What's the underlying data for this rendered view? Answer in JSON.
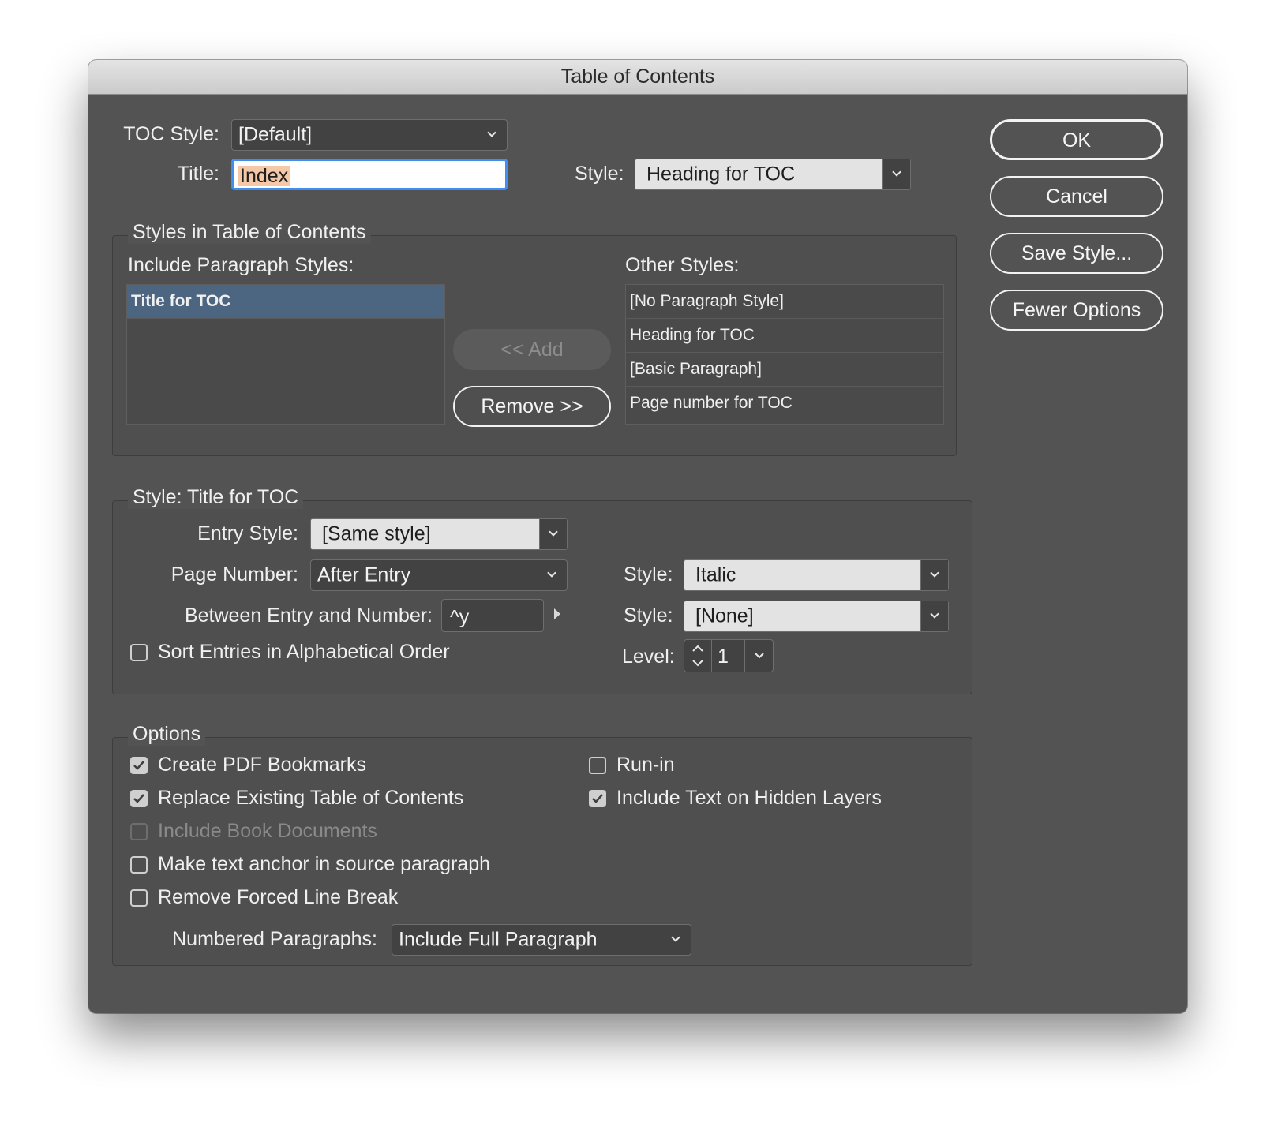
{
  "window": {
    "title": "Table of Contents"
  },
  "top": {
    "toc_style_label": "TOC Style:",
    "toc_style_value": "[Default]",
    "title_label": "Title:",
    "title_value": "Index",
    "style_label": "Style:",
    "style_value": "Heading for TOC"
  },
  "buttons": {
    "ok": "OK",
    "cancel": "Cancel",
    "save_style": "Save Style...",
    "fewer_options": "Fewer Options"
  },
  "styles_in_toc": {
    "group_title": "Styles in Table of Contents",
    "include_label": "Include Paragraph Styles:",
    "include_items": [
      "Title for TOC"
    ],
    "add_label": "<< Add",
    "remove_label": "Remove >>",
    "other_label": "Other Styles:",
    "other_items": [
      "[No Paragraph Style]",
      "Heading for TOC",
      "[Basic Paragraph]",
      "Page number for TOC"
    ]
  },
  "style_section": {
    "group_title": "Style: Title for TOC",
    "entry_style_label": "Entry Style:",
    "entry_style_value": "[Same style]",
    "page_number_label": "Page Number:",
    "page_number_value": "After Entry",
    "page_number_style_label": "Style:",
    "page_number_style_value": "Italic",
    "between_label": "Between Entry and Number:",
    "between_value": "^y",
    "between_style_label": "Style:",
    "between_style_value": "[None]",
    "sort_label": "Sort Entries in Alphabetical Order",
    "sort_checked": false,
    "level_label": "Level:",
    "level_value": "1"
  },
  "options": {
    "group_title": "Options",
    "create_pdf_bookmarks": "Create PDF Bookmarks",
    "replace_existing": "Replace Existing Table of Contents",
    "include_book_documents": "Include Book Documents",
    "make_text_anchor": "Make text anchor in source paragraph",
    "remove_forced_line_break": "Remove Forced Line Break",
    "run_in": "Run-in",
    "include_hidden_layers": "Include Text on Hidden Layers",
    "numbered_paragraphs_label": "Numbered Paragraphs:",
    "numbered_paragraphs_value": "Include Full Paragraph"
  },
  "colors": {
    "dialog_bg": "#535353",
    "selection_bg": "#4c6580",
    "title_highlight": "#f5c9a8",
    "focus_ring": "#3f8ef0"
  }
}
